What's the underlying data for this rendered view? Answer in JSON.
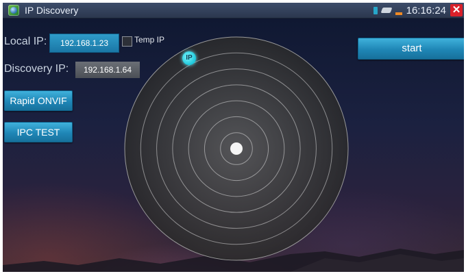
{
  "window": {
    "title": "IP Discovery"
  },
  "status": {
    "time": "16:16:24",
    "close_symbol": "✕"
  },
  "fields": {
    "local_ip_label": "Local IP:",
    "local_ip_value": "192.168.1.23",
    "temp_ip_label": "Temp IP",
    "temp_ip_checked": false,
    "discovery_ip_label": "Discovery IP:",
    "discovery_ip_value": "192.168.1.64"
  },
  "buttons": {
    "rapid_onvif": "Rapid ONVIF",
    "ipc_test": "IPC TEST",
    "start": "start"
  },
  "radar": {
    "marker_label": "IP",
    "ring_count": 6
  },
  "colors": {
    "accent": "#2a94c4",
    "marker": "#22d0e3",
    "close": "#d9202a"
  },
  "icons": [
    "app-icon",
    "sd-card-icon",
    "usb-icon",
    "battery-icon",
    "close-icon"
  ]
}
